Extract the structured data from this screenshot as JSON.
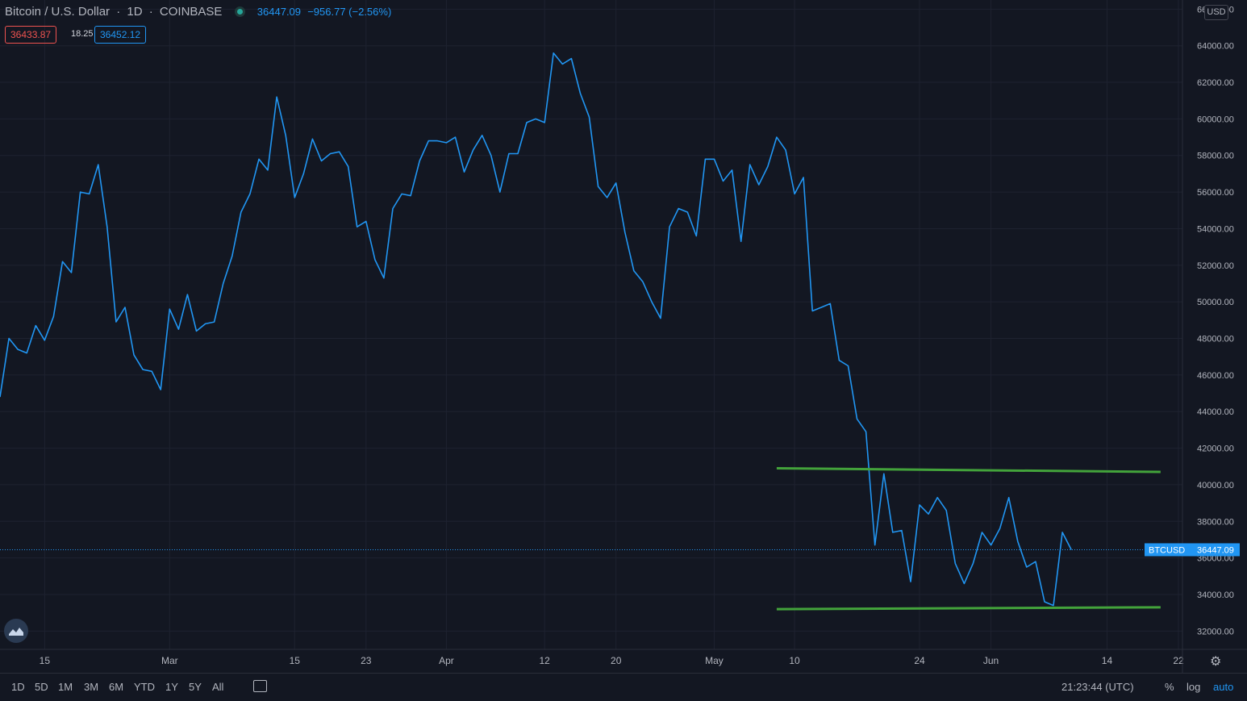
{
  "header": {
    "symbol": "Bitcoin / U.S. Dollar",
    "interval": "1D",
    "exchange": "COINBASE",
    "last_price": "36447.09",
    "change": "−956.77 (−2.56%)",
    "bid": "36433.87",
    "spread": "18.25",
    "ask": "36452.12"
  },
  "currency_label": "USD",
  "price_tag": {
    "symbol": "BTCUSD",
    "value": "36447.09"
  },
  "bottom_bar": {
    "ranges": [
      "1D",
      "5D",
      "1M",
      "3M",
      "6M",
      "YTD",
      "1Y",
      "5Y",
      "All"
    ],
    "time": "21:23:44 (UTC)",
    "options": [
      "%",
      "log",
      "auto"
    ],
    "active_option": "auto"
  },
  "colors": {
    "background": "#131722",
    "line": "#2196f3",
    "support_resistance": "#43a33b",
    "grid": "#1e2230",
    "text": "#b2b5be"
  },
  "chart_data": {
    "type": "line",
    "title": "Bitcoin / U.S. Dollar",
    "ylim": [
      31000,
      66500
    ],
    "grid": true,
    "y_ticks": [
      32000,
      34000,
      36000,
      38000,
      40000,
      42000,
      44000,
      46000,
      48000,
      50000,
      52000,
      54000,
      56000,
      58000,
      60000,
      62000,
      64000,
      66000
    ],
    "x_start": "2021-02-10",
    "x_end": "2021-06-22",
    "x_ticks": [
      {
        "date": "2021-02-15",
        "label": "15"
      },
      {
        "date": "2021-03-01",
        "label": "Mar"
      },
      {
        "date": "2021-03-15",
        "label": "15"
      },
      {
        "date": "2021-03-23",
        "label": "23"
      },
      {
        "date": "2021-04-01",
        "label": "Apr"
      },
      {
        "date": "2021-04-12",
        "label": "12"
      },
      {
        "date": "2021-04-20",
        "label": "20"
      },
      {
        "date": "2021-05-01",
        "label": "May"
      },
      {
        "date": "2021-05-10",
        "label": "10"
      },
      {
        "date": "2021-05-24",
        "label": "24"
      },
      {
        "date": "2021-06-01",
        "label": "Jun"
      },
      {
        "date": "2021-06-14",
        "label": "14"
      },
      {
        "date": "2021-06-22",
        "label": "22"
      }
    ],
    "series": [
      {
        "name": "BTCUSD",
        "start_date": "2021-02-10",
        "values": [
          44800,
          48000,
          47400,
          47200,
          48700,
          47900,
          49200,
          52200,
          51600,
          56000,
          55900,
          57500,
          54100,
          48900,
          49700,
          47100,
          46300,
          46200,
          45200,
          49600,
          48500,
          50400,
          48400,
          48800,
          48900,
          51000,
          52500,
          54900,
          55900,
          57800,
          57200,
          61200,
          59100,
          55700,
          57000,
          58900,
          57700,
          58100,
          58200,
          57400,
          54100,
          54400,
          52300,
          51300,
          55100,
          55900,
          55800,
          57700,
          58800,
          58800,
          58700,
          59000,
          57100,
          58300,
          59100,
          58000,
          56000,
          58100,
          58100,
          59800,
          60000,
          59800,
          63600,
          63000,
          63300,
          61400,
          60100,
          56300,
          55700,
          56500,
          53800,
          51700,
          51100,
          50000,
          49100,
          54100,
          55100,
          54900,
          53600,
          57800,
          57800,
          56600,
          57200,
          53300,
          57500,
          56400,
          57400,
          59000,
          58300,
          55900,
          56800,
          49500,
          49700,
          49900,
          46800,
          46500,
          43600,
          42900,
          36700,
          40600,
          37400,
          37500,
          34700,
          38900,
          38400,
          39300,
          38600,
          35700,
          34600,
          35700,
          37400,
          36700,
          37600,
          39300,
          36900,
          35500,
          35800,
          33600,
          33400,
          37400,
          36447
        ]
      }
    ],
    "annotations": [
      {
        "type": "trendline",
        "from": {
          "date": "2021-05-08",
          "value": 40900
        },
        "to": {
          "date": "2021-06-20",
          "value": 40700
        }
      },
      {
        "type": "trendline",
        "from": {
          "date": "2021-05-08",
          "value": 33200
        },
        "to": {
          "date": "2021-06-20",
          "value": 33300
        }
      }
    ],
    "last_value_line": 36447.09
  }
}
